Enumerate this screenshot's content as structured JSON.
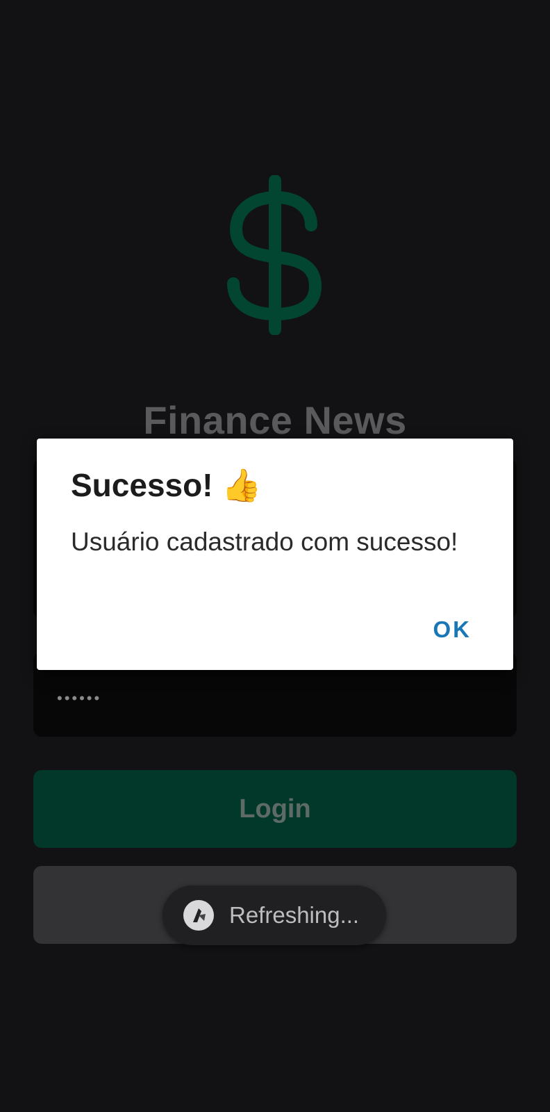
{
  "app": {
    "title": "Finance News",
    "logo_icon": "dollar-sign-icon",
    "accent_color": "#024530"
  },
  "form": {
    "password_value": "••••••",
    "login_label": "Login"
  },
  "dialog": {
    "title": "Sucesso! 👍",
    "message": "Usuário cadastrado com sucesso!",
    "ok_label": "OK"
  },
  "toast": {
    "text": "Refreshing...",
    "icon": "app-refresh-icon"
  }
}
